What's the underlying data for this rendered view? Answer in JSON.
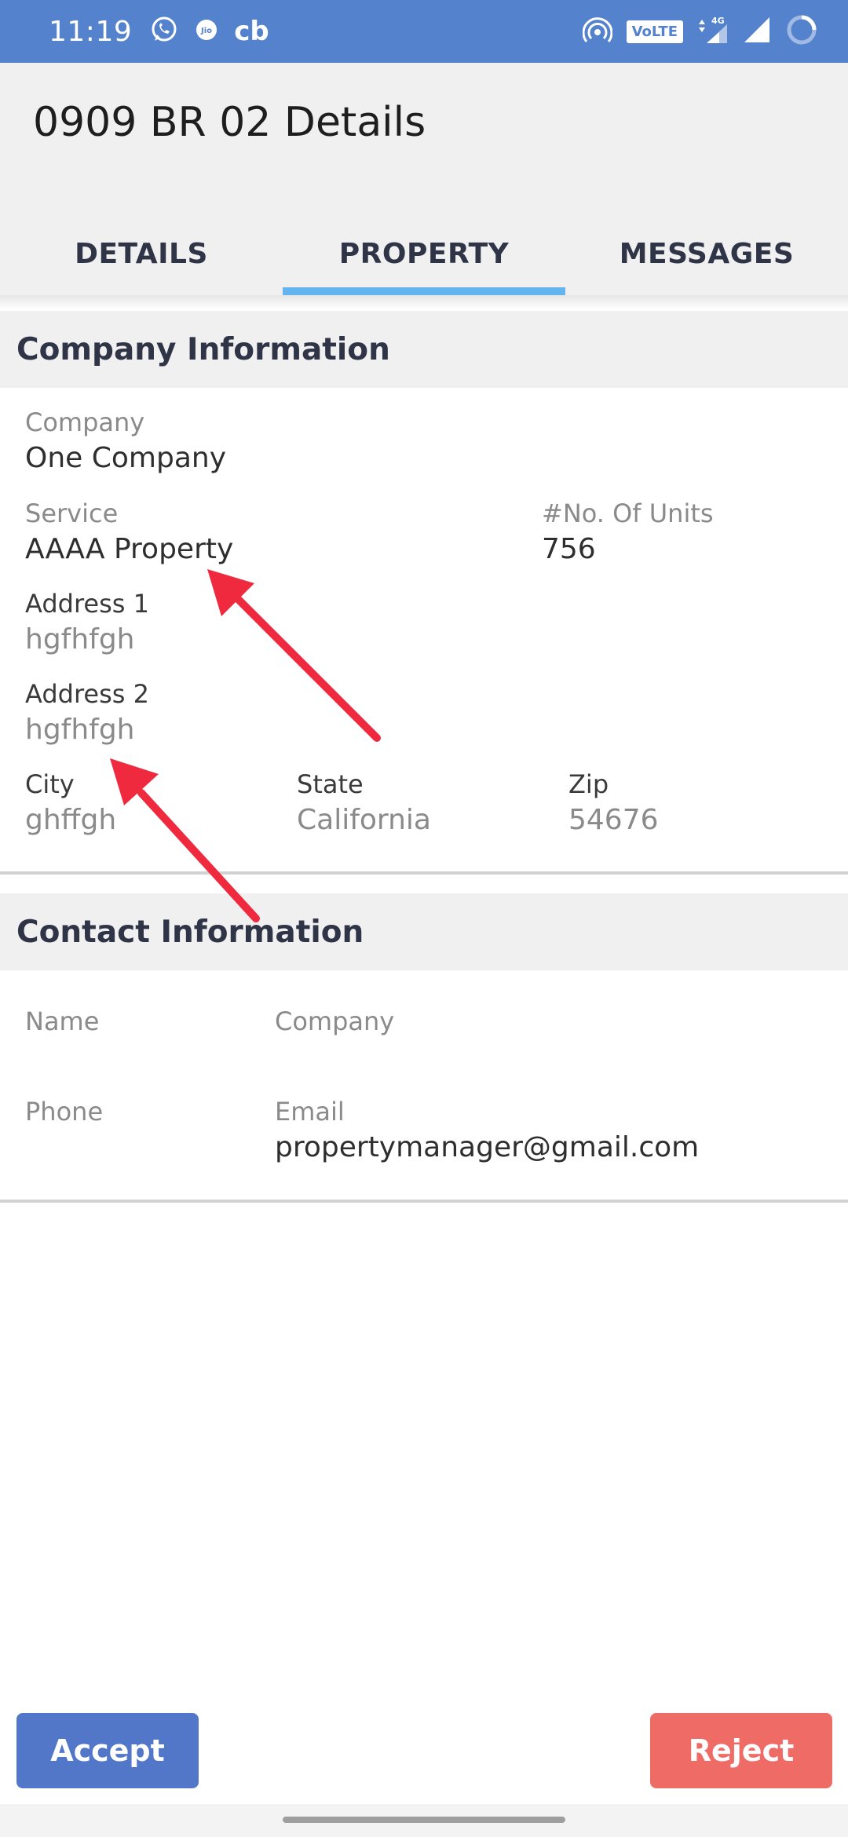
{
  "status_bar": {
    "time": "11:19",
    "cb": "cb",
    "volte": "VoLTE",
    "network": "4G",
    "icons": [
      "whatsapp-icon",
      "jio-icon",
      "hotspot-icon",
      "signal-icon",
      "wifi-signal-icon",
      "loading-icon"
    ]
  },
  "header": {
    "title": "0909 BR 02 Details",
    "tabs": [
      {
        "label": "DETAILS",
        "selected": false
      },
      {
        "label": "PROPERTY",
        "selected": true
      },
      {
        "label": "MESSAGES",
        "selected": false
      }
    ],
    "indicator_color": "#64b4f0"
  },
  "company_section": {
    "title": "Company Information",
    "company_label": "Company",
    "company_value": "One Company",
    "service_label": "Service",
    "service_value": "AAAA Property",
    "units_label": "#No. Of Units",
    "units_value": "756",
    "address1_label": "Address 1",
    "address1_value": "hgfhfgh",
    "address2_label": "Address 2",
    "address2_value": "hgfhfgh",
    "city_label": "City",
    "city_value": "ghffgh",
    "state_label": "State",
    "state_value": "California",
    "zip_label": "Zip",
    "zip_value": "54676"
  },
  "contact_section": {
    "title": "Contact Information",
    "name_label": "Name",
    "company_label": "Company",
    "phone_label": "Phone",
    "email_label": "Email",
    "email_value": "propertymanager@gmail.com"
  },
  "actions": {
    "accept_label": "Accept",
    "reject_label": "Reject",
    "accept_color": "#5277c8",
    "reject_color": "#ee6b66"
  },
  "annotation_color": "#ef2a3f"
}
